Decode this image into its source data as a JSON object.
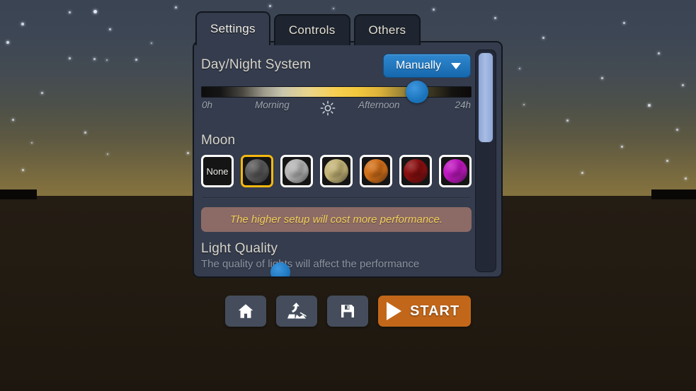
{
  "scene": {
    "description": "twilight sky over dark terrain with stars"
  },
  "tabs": [
    {
      "label": "Settings",
      "active": true
    },
    {
      "label": "Controls",
      "active": false
    },
    {
      "label": "Others",
      "active": false
    }
  ],
  "daynight": {
    "title": "Day/Night System",
    "mode_value": "Manually",
    "slider": {
      "value_percent": 80,
      "ticks": {
        "start": "0h",
        "morning": "Morning",
        "afternoon": "Afternoon",
        "end": "24h"
      },
      "sun_icon": "sun-icon"
    }
  },
  "moon": {
    "title": "Moon",
    "options": [
      {
        "name": "None",
        "label": "None",
        "color": null,
        "selected": false
      },
      {
        "name": "Gray",
        "label": "",
        "color": "#5a5a5a",
        "selected": true
      },
      {
        "name": "White",
        "label": "",
        "color": "#b4b4b4",
        "selected": false
      },
      {
        "name": "Khaki",
        "label": "",
        "color": "#c4b477",
        "selected": false
      },
      {
        "name": "Orange",
        "label": "",
        "color": "#d2701a",
        "selected": false
      },
      {
        "name": "Red",
        "label": "",
        "color": "#8a0f10",
        "selected": false
      },
      {
        "name": "Magenta",
        "label": "",
        "color": "#bf18bf",
        "selected": false
      }
    ]
  },
  "warning": {
    "text": "The higher setup will cost more performance."
  },
  "light_quality": {
    "title": "Light Quality",
    "subtitle": "The quality of lights will affect the performance"
  },
  "scrollbar": {
    "thumb_position_percent": 0
  },
  "buttons": {
    "home": {
      "icon": "home-icon",
      "label": ""
    },
    "reset_terrain": {
      "icon": "terrain-reset-icon",
      "label": ""
    },
    "save": {
      "icon": "floppy-save-icon",
      "label": ""
    },
    "start": {
      "icon": "play-icon",
      "label": "START"
    }
  },
  "colors": {
    "panel_bg": "#343c4d",
    "tab_inactive": "#1e2530",
    "accent_blue": "#1b75bd",
    "accent_orange": "#c2671a",
    "selected_border": "#f5b810",
    "warning_bg": "#8c6a66",
    "warning_text": "#f1cf5a"
  }
}
